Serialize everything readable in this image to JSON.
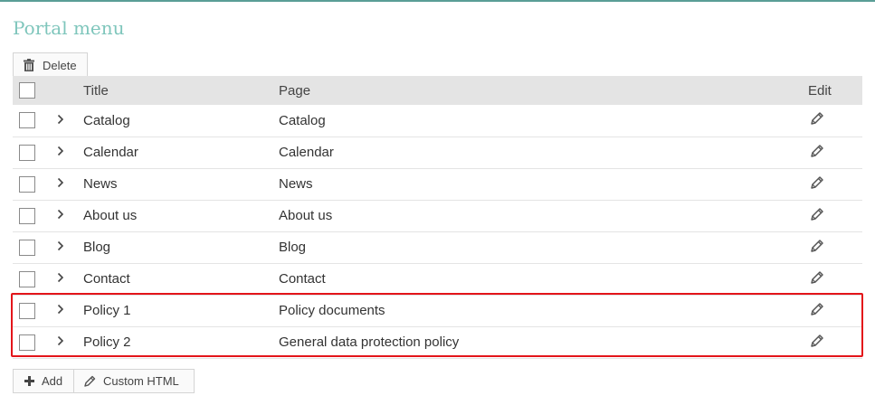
{
  "header": {
    "title": "Portal menu"
  },
  "toolbar": {
    "delete_label": "Delete",
    "delete_icon": "trash-icon"
  },
  "table": {
    "columns": {
      "title": "Title",
      "page": "Page",
      "edit": "Edit"
    },
    "rows": [
      {
        "title": "Catalog",
        "page": "Catalog"
      },
      {
        "title": "Calendar",
        "page": "Calendar"
      },
      {
        "title": "News",
        "page": "News"
      },
      {
        "title": "About us",
        "page": "About us"
      },
      {
        "title": "Blog",
        "page": "Blog"
      },
      {
        "title": "Contact",
        "page": "Contact"
      },
      {
        "title": "Policy 1",
        "page": "Policy documents"
      },
      {
        "title": "Policy 2",
        "page": "General data protection policy"
      }
    ]
  },
  "footer": {
    "add_label": "Add",
    "custom_html_label": "Custom HTML"
  },
  "colors": {
    "accent": "#7fc6bc",
    "highlight": "#e3151a",
    "header_bg": "#e4e4e4"
  }
}
